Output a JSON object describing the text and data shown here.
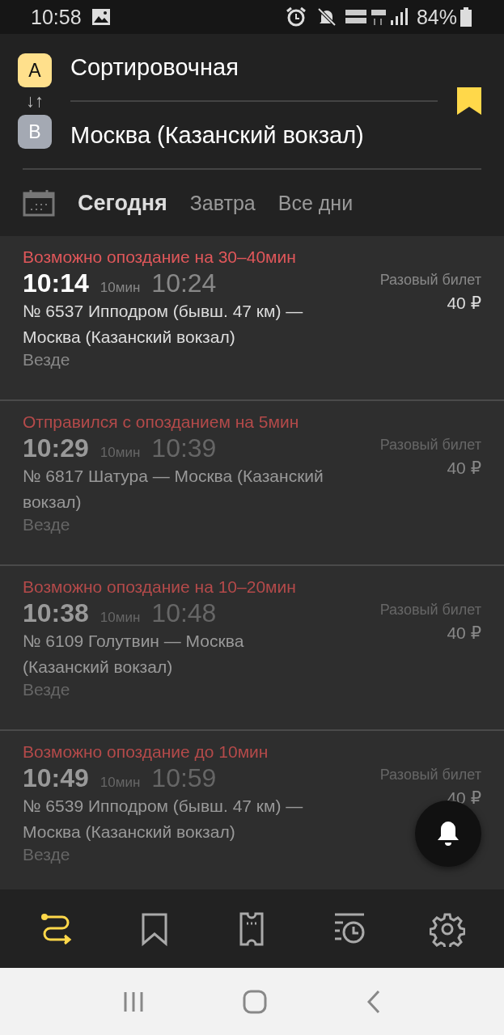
{
  "status_bar": {
    "time": "10:58",
    "battery": "84%"
  },
  "route": {
    "from_badge": "A",
    "from": "Сортировочная",
    "swap": "↓↑",
    "to_badge": "B",
    "to": "Москва (Казанский вокзал)",
    "favorite": true
  },
  "day_tabs": [
    {
      "label": "Сегодня",
      "selected": true
    },
    {
      "label": "Завтра",
      "selected": false
    },
    {
      "label": "Все дни",
      "selected": false
    }
  ],
  "trains": [
    {
      "alert": "Возможно опоздание на 30–40мин",
      "departure": "10:14",
      "duration": "10мин",
      "arrival": "10:24",
      "route": "№ 6537 Ипподром (бывш. 47 км) — Москва (Казанский вокзал)",
      "stops": "Везде",
      "fare": "Разовый билет",
      "price": "40 ₽",
      "departed": false
    },
    {
      "alert": "Отправился с опозданием на 5мин",
      "departure": "10:29",
      "duration": "10мин",
      "arrival": "10:39",
      "route": "№ 6817 Шатура — Москва (Казанский вокзал)",
      "stops": "Везде",
      "fare": "Разовый билет",
      "price": "40 ₽",
      "departed": true
    },
    {
      "alert": "Возможно опоздание на 10–20мин",
      "departure": "10:38",
      "duration": "10мин",
      "arrival": "10:48",
      "route": "№ 6109 Голутвин — Москва (Казанский вокзал)",
      "stops": "Везде",
      "fare": "Разовый билет",
      "price": "40 ₽",
      "departed": true
    },
    {
      "alert": "Возможно опоздание до 10мин",
      "departure": "10:49",
      "duration": "10мин",
      "arrival": "10:59",
      "route": "№ 6539 Ипподром (бывш. 47 км) — Москва (Казанский вокзал)",
      "stops": "Везде",
      "fare": "Разовый билет",
      "price": "40 ₽",
      "departed": true
    }
  ],
  "bottom_nav": [
    {
      "kind": "routes",
      "selected": true
    },
    {
      "kind": "favorites",
      "selected": false
    },
    {
      "kind": "tickets",
      "selected": false
    },
    {
      "kind": "history",
      "selected": false
    },
    {
      "kind": "settings",
      "selected": false
    }
  ]
}
